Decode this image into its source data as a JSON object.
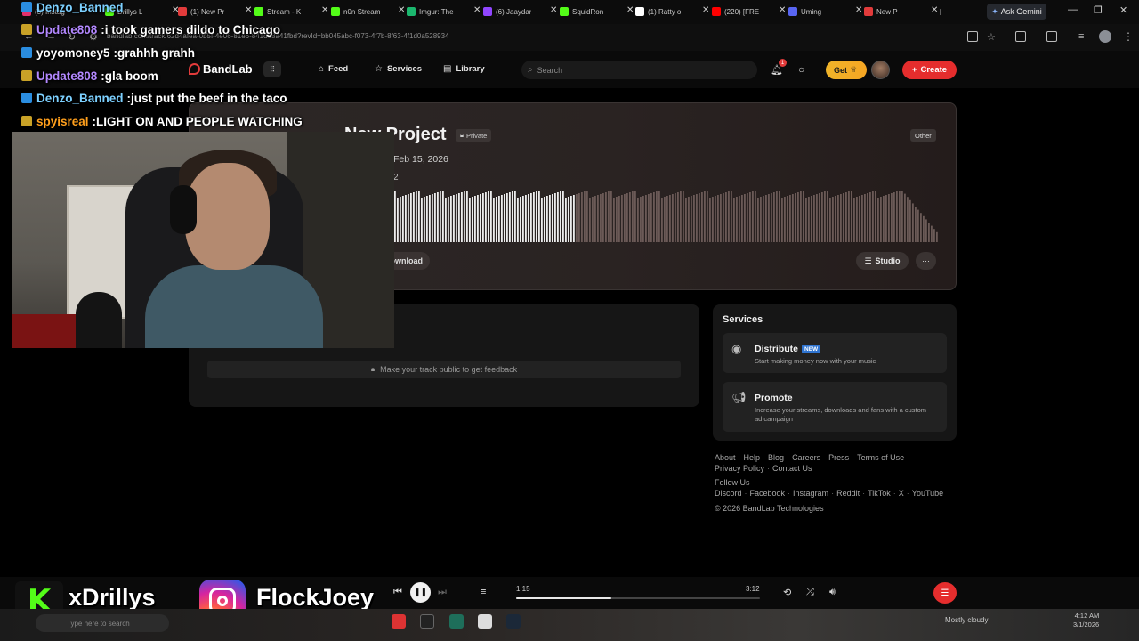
{
  "browser": {
    "tabs": [
      {
        "title": "(3) Instag",
        "color": "#e1306c"
      },
      {
        "title": "Drillys L",
        "color": "#53fc18"
      },
      {
        "title": "(1) New Pr",
        "color": "#e23b3b"
      },
      {
        "title": "Stream - K",
        "color": "#53fc18"
      },
      {
        "title": "n0n Stream",
        "color": "#53fc18"
      },
      {
        "title": "Imgur: The",
        "color": "#1bb76e"
      },
      {
        "title": "(6) Jaaydar",
        "color": "#9146ff"
      },
      {
        "title": "SquidRon",
        "color": "#53fc18"
      },
      {
        "title": "(1) Ratty o",
        "color": "#ffffff"
      },
      {
        "title": "(220) [FRE",
        "color": "#ff0000"
      },
      {
        "title": "Uming",
        "color": "#5865f2"
      },
      {
        "title": "New P",
        "color": "#e23b3b"
      }
    ],
    "new_tab": "+",
    "ask_gemini": "Ask Gemini",
    "url": "bandlab.com/track/62d4afea-0b5f-4e06-81e6-841de8a41fbd?revId=bb045abc-f073-4f7b-8f63-4f1d0a528934"
  },
  "header": {
    "logo": "BandLab",
    "nav": {
      "feed": "Feed",
      "services": "Services",
      "library": "Library"
    },
    "search_placeholder": "Search",
    "notification_count": "1",
    "get_label": "Get",
    "create_label": "Create"
  },
  "project": {
    "title": "New Project",
    "visibility": "Private",
    "date": "Feb 15, 2026",
    "number": "2",
    "genre_tag": "Other",
    "download_label": "Download",
    "studio_label": "Studio",
    "more_label": "···",
    "playback_fraction": 0.333
  },
  "feedback": {
    "message": "Make your track public to get feedback"
  },
  "services": {
    "title": "Services",
    "items": [
      {
        "name": "Distribute",
        "badge": "NEW",
        "desc": "Start making money now with your music"
      },
      {
        "name": "Promote",
        "badge": "",
        "desc": "Increase your streams, downloads and fans with a custom ad campaign"
      }
    ]
  },
  "footer": {
    "links": [
      "About",
      "Help",
      "Blog",
      "Careers",
      "Press",
      "Terms of Use",
      "Privacy Policy",
      "Contact Us"
    ],
    "follow_us": "Follow Us",
    "social": [
      "Discord",
      "Facebook",
      "Instagram",
      "Reddit",
      "TikTok",
      "X",
      "YouTube"
    ],
    "copyright": "© 2026 BandLab Technologies"
  },
  "chat": [
    {
      "user": "Denzo_Banned",
      "message": "",
      "color": "#7cd0ff"
    },
    {
      "user": "Update808",
      "message": "i took gamers dildo to Chicago",
      "color": "#b388ff"
    },
    {
      "user": "yoyomoney5",
      "message": "grahhh grahh",
      "color": "#ffffff"
    },
    {
      "user": "Update808",
      "message": "gla boom",
      "color": "#b388ff"
    },
    {
      "user": "Denzo_Banned",
      "message": "just put the beef in the taco",
      "color": "#7cd0ff"
    },
    {
      "user": "spyisreal",
      "message": "LIGHT ON AND PEOPLE WATCHING",
      "color": "#ff9f1c"
    }
  ],
  "player": {
    "current_time": "1:15",
    "total_time": "3:12",
    "progress_fraction": 0.39
  },
  "overlay": {
    "kick_name": "xDrillys",
    "instagram_name": "FlockJoey"
  },
  "taskbar": {
    "search_placeholder": "Type here to search",
    "weather": "Mostly cloudy",
    "time": "4:12 AM",
    "date": "3/1/2026"
  }
}
